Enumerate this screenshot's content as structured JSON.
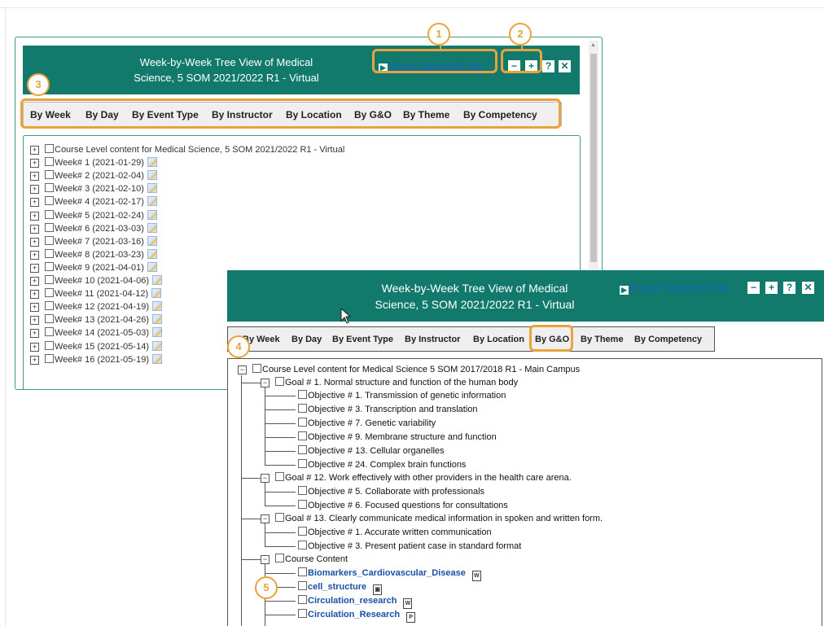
{
  "panel_a": {
    "title_line1": "Week-by-Week Tree View of Medical",
    "title_line2": "Science, 5 SOM 2021/2022 R1 - Virtual",
    "export_label": "Export Selected Files",
    "buttons": {
      "collapse": "−",
      "expand": "+",
      "help": "?",
      "close": "✕"
    },
    "tabs": [
      "By Week",
      "By Day",
      "By Event Type",
      "By Instructor",
      "By Location",
      "By G&O",
      "By Theme",
      "By Competency"
    ],
    "tree": [
      "Course Level content for Medical Science, 5 SOM 2021/2022 R1 - Virtual",
      "Week# 1 (2021-01-29)",
      "Week# 2 (2021-02-04)",
      "Week# 3 (2021-02-10)",
      "Week# 4 (2021-02-17)",
      "Week# 5 (2021-02-24)",
      "Week# 6 (2021-03-03)",
      "Week# 7 (2021-03-16)",
      "Week# 8 (2021-03-23)",
      "Week# 9 (2021-04-01)",
      "Week# 10 (2021-04-06)",
      "Week# 11 (2021-04-12)",
      "Week# 12 (2021-04-19)",
      "Week# 13 (2021-04-26)",
      "Week# 14 (2021-05-03)",
      "Week# 15 (2021-05-14)",
      "Week# 16 (2021-05-19)"
    ]
  },
  "panel_b": {
    "title_line1": "Week-by-Week Tree View of Medical",
    "title_line2": "Science, 5 SOM 2021/2022 R1 - Virtual",
    "export_label": "Export Selected Files",
    "buttons": {
      "collapse": "−",
      "expand": "+",
      "help": "?",
      "close": "✕"
    },
    "tabs": [
      "By Week",
      "By Day",
      "By Event Type",
      "By Instructor",
      "By Location",
      "By G&O",
      "By Theme",
      "By Competency"
    ],
    "selected_tab": "By G&O",
    "tree": {
      "root": "Course Level content for Medical Science 5 SOM 2017/2018 R1 - Main Campus",
      "goal1": "Goal # 1. Normal structure and function of the human body",
      "goal1_objectives": [
        "Objective # 1. Transmission of genetic information",
        "Objective # 3. Transcription and translation",
        "Objective # 7. Genetic variability",
        "Objective # 9. Membrane structure and function",
        "Objective # 13. Cellular organelles",
        "Objective # 24. Complex brain functions"
      ],
      "goal12": "Goal # 12. Work effectively with other providers in the health care arena.",
      "goal12_objectives": [
        "Objective # 5. Collaborate with professionals",
        "Objective # 6. Focused questions for consultations"
      ],
      "goal13": "Goal # 13. Clearly communicate medical information in spoken and written form.",
      "goal13_objectives": [
        "Objective # 1. Accurate written communication",
        "Objective # 3. Present patient case in standard format"
      ],
      "course_content": "Course Content",
      "files": [
        {
          "name": "Biomarkers_Cardiovascular_Disease",
          "icon": "W"
        },
        {
          "name": "cell_structure",
          "icon": "▣"
        },
        {
          "name": "Circulation_research",
          "icon": "W"
        },
        {
          "name": "Circulation_Research",
          "icon": "P"
        }
      ]
    }
  },
  "callouts": [
    "1",
    "2",
    "3",
    "4",
    "5"
  ],
  "colors": {
    "header": "#127a6c",
    "highlight": "#e8a33c",
    "link": "#1b5fc2"
  }
}
